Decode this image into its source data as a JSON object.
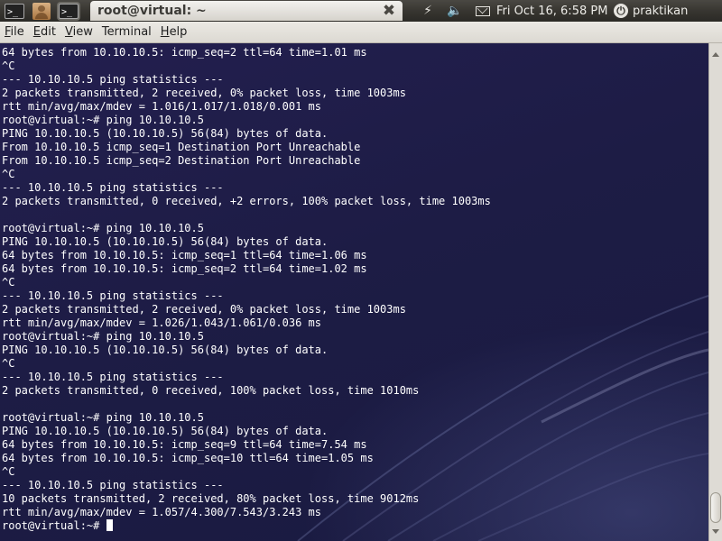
{
  "panel": {
    "launchers": [
      {
        "name": "terminal-launcher",
        "icon": "terminal-icon",
        "glyph": ">_"
      },
      {
        "name": "user-launcher",
        "icon": "user-folder-icon"
      },
      {
        "name": "terminal-launcher-active",
        "icon": "terminal-icon",
        "glyph": ">_"
      }
    ],
    "window_title": "root@virtual: ~",
    "close_glyph": "✖",
    "network_glyph": "⚡",
    "volume_glyph": "🔈",
    "clock": "Fri Oct 16,  6:58 PM",
    "session_user": "praktikan",
    "session_glyph": "⏻"
  },
  "menubar": [
    {
      "accel": "F",
      "rest": "ile"
    },
    {
      "accel": "E",
      "rest": "dit"
    },
    {
      "accel": "V",
      "rest": "iew"
    },
    {
      "accel": "T",
      "rest": "erminal",
      "plain": true
    },
    {
      "accel": "H",
      "rest": "elp"
    }
  ],
  "terminal": {
    "lines": [
      "64 bytes from 10.10.10.5: icmp_seq=2 ttl=64 time=1.01 ms",
      "^C",
      "--- 10.10.10.5 ping statistics ---",
      "2 packets transmitted, 2 received, 0% packet loss, time 1003ms",
      "rtt min/avg/max/mdev = 1.016/1.017/1.018/0.001 ms",
      "root@virtual:~# ping 10.10.10.5",
      "PING 10.10.10.5 (10.10.10.5) 56(84) bytes of data.",
      "From 10.10.10.5 icmp_seq=1 Destination Port Unreachable",
      "From 10.10.10.5 icmp_seq=2 Destination Port Unreachable",
      "^C",
      "--- 10.10.10.5 ping statistics ---",
      "2 packets transmitted, 0 received, +2 errors, 100% packet loss, time 1003ms",
      "",
      "root@virtual:~# ping 10.10.10.5",
      "PING 10.10.10.5 (10.10.10.5) 56(84) bytes of data.",
      "64 bytes from 10.10.10.5: icmp_seq=1 ttl=64 time=1.06 ms",
      "64 bytes from 10.10.10.5: icmp_seq=2 ttl=64 time=1.02 ms",
      "^C",
      "--- 10.10.10.5 ping statistics ---",
      "2 packets transmitted, 2 received, 0% packet loss, time 1003ms",
      "rtt min/avg/max/mdev = 1.026/1.043/1.061/0.036 ms",
      "root@virtual:~# ping 10.10.10.5",
      "PING 10.10.10.5 (10.10.10.5) 56(84) bytes of data.",
      "^C",
      "--- 10.10.10.5 ping statistics ---",
      "2 packets transmitted, 0 received, 100% packet loss, time 1010ms",
      "",
      "root@virtual:~# ping 10.10.10.5",
      "PING 10.10.10.5 (10.10.10.5) 56(84) bytes of data.",
      "64 bytes from 10.10.10.5: icmp_seq=9 ttl=64 time=7.54 ms",
      "64 bytes from 10.10.10.5: icmp_seq=10 ttl=64 time=1.05 ms",
      "^C",
      "--- 10.10.10.5 ping statistics ---",
      "10 packets transmitted, 2 received, 80% packet loss, time 9012ms",
      "rtt min/avg/max/mdev = 1.057/4.300/7.543/3.243 ms",
      "root@virtual:~# "
    ]
  },
  "colors": {
    "terminal_bg": "#1d1c45",
    "terminal_fg": "#ffffff",
    "panel_bg": "#3c3b37",
    "menubar_bg": "#e5e2dc"
  }
}
